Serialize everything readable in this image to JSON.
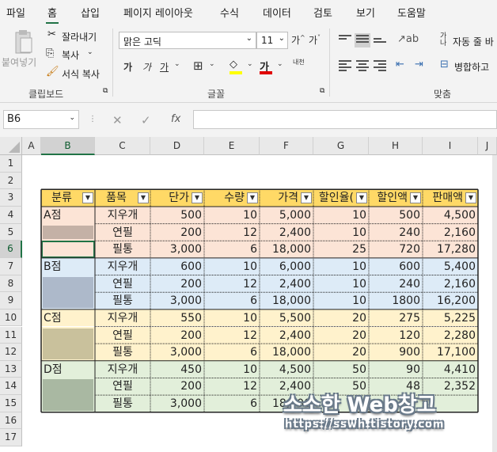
{
  "menu": {
    "items": [
      "파일",
      "홈",
      "삽입",
      "페이지 레이아웃",
      "수식",
      "데이터",
      "검토",
      "보기",
      "도움말"
    ],
    "active": "홈"
  },
  "ribbon": {
    "clipboard": {
      "paste": "붙여넣기",
      "cut": "잘라내기",
      "copy": "복사",
      "format_painter": "서식 복사",
      "label": "클립보드"
    },
    "font": {
      "name": "맑은 고딕",
      "size": "11",
      "bold": "가",
      "italic": "가",
      "underline": "가",
      "phonetic": "내천",
      "label": "글꼴"
    },
    "alignment": {
      "wrap": "자동 줄 바",
      "merge": "병합하고",
      "label": "맞춤"
    }
  },
  "formula_bar": {
    "name_box": "B6",
    "fx": "fx",
    "content": ""
  },
  "columns": [
    "A",
    "B",
    "C",
    "D",
    "E",
    "F",
    "G",
    "H",
    "I",
    "J"
  ],
  "rows": [
    "1",
    "2",
    "3",
    "4",
    "5",
    "6",
    "7",
    "8",
    "9",
    "10",
    "11",
    "12",
    "13",
    "14",
    "15",
    "16",
    "17"
  ],
  "table": {
    "headers": [
      "분류",
      "품목",
      "단가",
      "수량",
      "가격",
      "할인율(",
      "할인액",
      "판매액"
    ],
    "rows": [
      [
        "A점",
        "지우개",
        "500",
        "10",
        "5,000",
        "10",
        "500",
        "4,500"
      ],
      [
        "A점",
        "연필",
        "200",
        "12",
        "2,400",
        "10",
        "240",
        "2,160"
      ],
      [
        "",
        "필통",
        "3,000",
        "6",
        "18,000",
        "25",
        "720",
        "17,280"
      ],
      [
        "B점",
        "지우개",
        "600",
        "10",
        "6,000",
        "10",
        "600",
        "5,400"
      ],
      [
        "",
        "연필",
        "200",
        "12",
        "2,400",
        "10",
        "240",
        "2,160"
      ],
      [
        "",
        "필통",
        "3,000",
        "6",
        "18,000",
        "10",
        "1800",
        "16,200"
      ],
      [
        "C점",
        "지우개",
        "550",
        "10",
        "5,500",
        "20",
        "275",
        "5,225"
      ],
      [
        "",
        "연필",
        "200",
        "12",
        "2,400",
        "20",
        "120",
        "2,280"
      ],
      [
        "",
        "필통",
        "3,000",
        "6",
        "18,000",
        "20",
        "900",
        "17,100"
      ],
      [
        "D점",
        "지우개",
        "450",
        "10",
        "4,500",
        "50",
        "90",
        "4,410"
      ],
      [
        "",
        "연필",
        "200",
        "12",
        "2,400",
        "50",
        "48",
        "2,352"
      ],
      [
        "",
        "필통",
        "3,000",
        "6",
        "18,000",
        "",
        "",
        ""
      ]
    ]
  },
  "colors": {
    "header_fill": "#FFD966",
    "group_a": "#FCE4D6",
    "group_b": "#DDEBF7",
    "group_c": "#FFF2CC",
    "group_d": "#E2EFDA",
    "swatch_a": "#C4B1A6",
    "swatch_b": "#ADB9CA",
    "swatch_c": "#C9C19C",
    "swatch_d": "#A9B8A2",
    "excel_green": "#217346"
  },
  "watermark": {
    "title": "소소한 Web창고",
    "url": "https://sswh.tistory.com"
  }
}
